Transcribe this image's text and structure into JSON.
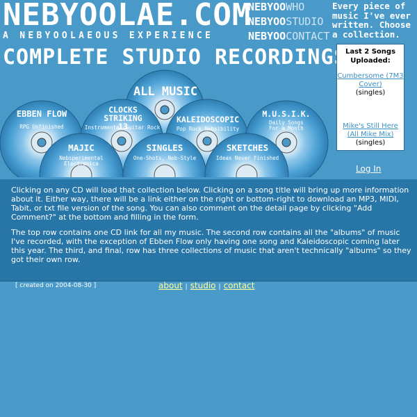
{
  "header": {
    "logo": "NEBYOOLAE.COM",
    "tagline": "A NEBYOOLAEOUS EXPERIENCE",
    "title": "COMPLETE STUDIO RECORDINGS",
    "blurb": "Every piece of music I've ever written. Choose a collection."
  },
  "nav": [
    {
      "prefix": "NEBYOO",
      "suffix": "WHO"
    },
    {
      "prefix": "NEBYOO",
      "suffix": "STUDIO"
    },
    {
      "prefix": "NEBYOO",
      "suffix": "CONTACT"
    }
  ],
  "recent": {
    "heading": "Last 2 Songs Uploaded:",
    "songs": [
      {
        "title": "Cumbersome (7M3 Cover)",
        "category": "(singles)"
      },
      {
        "title": "Mike's Still Here (All Mike Mix)",
        "category": "(singles)"
      }
    ]
  },
  "login": "Log In",
  "cds": [
    {
      "title": "EBBEN FLOW",
      "subtitle": "RPG Unfinished"
    },
    {
      "title": "CLOCKS STRIKING 13",
      "subtitle": "Instrumental Guitar Rock"
    },
    {
      "title": "ALL MUSIC",
      "subtitle": ""
    },
    {
      "title": "KALEIDOSCOPIC",
      "subtitle": "Pop Rock Nebsibility"
    },
    {
      "title": "M.U.S.I.K.",
      "subtitle": "Daily Songs For a Month"
    },
    {
      "title": "MAJIC",
      "subtitle": "Nebsperimental Electronica"
    },
    {
      "title": "SINGLES",
      "subtitle": "One-Shots, Neb-Style"
    },
    {
      "title": "SKETCHES",
      "subtitle": "Ideas Never Finished"
    }
  ],
  "info": {
    "p1": "Clicking on any CD will load that collection below. Clicking on a song title will bring up more information about it. Either way, there will be a link either on the right or bottom-right to download an MP3, MIDI, Tabit, or txt file version of the song. You can also comment on the detail page by clicking \"Add Comment?\" at the bottom and filling in the form.",
    "p2": "The top row contains one CD link for all my music. The second row contains all the \"albums\" of music I've recorded, with the exception of Ebben Flow only having one song and Kaleidoscopic coming later this year. The third, and final, row has three collections of music that aren't technically \"albums\" so they got their own row."
  },
  "footer": {
    "created": "[ created on 2004-08-30 ]",
    "links": [
      "about",
      "studio",
      "contact"
    ],
    "separator": "|"
  },
  "colors": {
    "background": "#4a9ac9",
    "panel": "#2876a8",
    "link_yellow": "#ffff99",
    "cd_blue": "#5aa9da"
  }
}
